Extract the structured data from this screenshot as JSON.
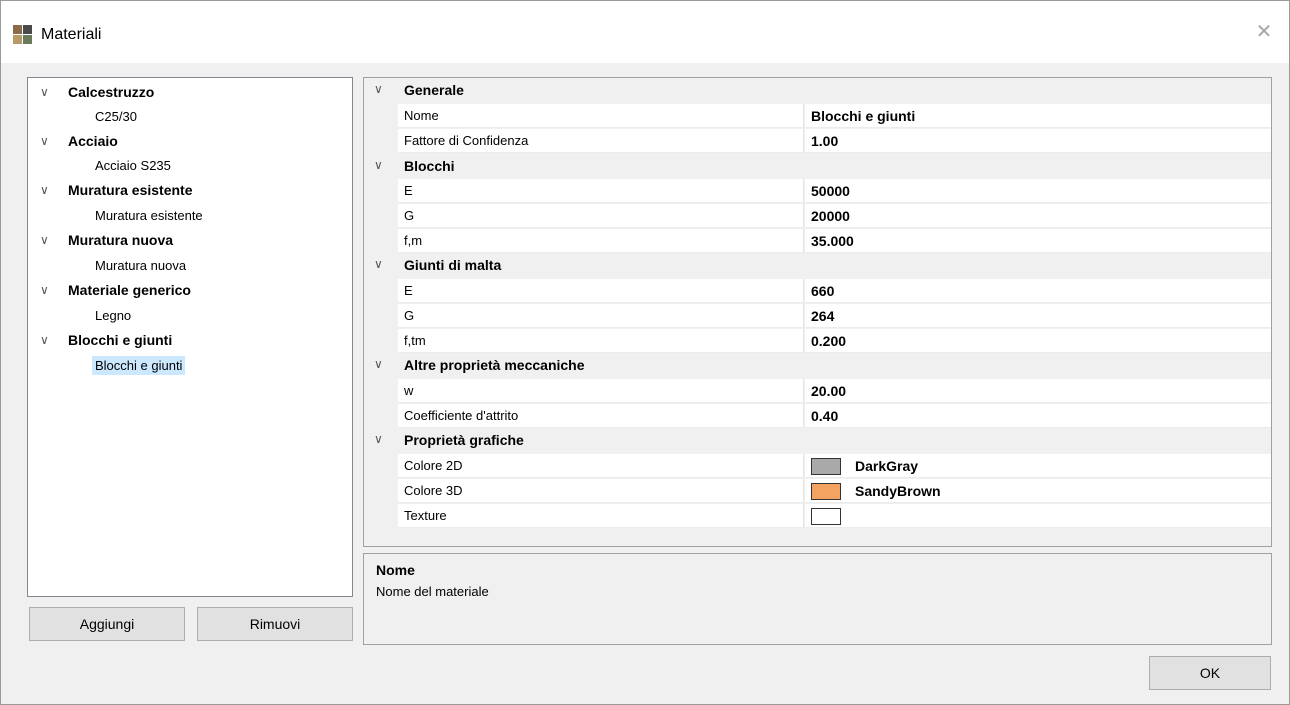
{
  "window": {
    "title": "Materiali",
    "close_glyph": "✕"
  },
  "tree": [
    {
      "category": "Calcestruzzo",
      "child": "C25/30"
    },
    {
      "category": "Acciaio",
      "child": "Acciaio S235"
    },
    {
      "category": "Muratura esistente",
      "child": "Muratura esistente"
    },
    {
      "category": "Muratura nuova",
      "child": "Muratura nuova"
    },
    {
      "category": "Materiale generico",
      "child": "Legno"
    },
    {
      "category": "Blocchi e giunti",
      "child": "Blocchi e giunti",
      "selected": true
    }
  ],
  "buttons": {
    "add": "Aggiungi",
    "remove": "Rimuovi",
    "ok": "OK"
  },
  "properties": {
    "generale": {
      "label": "Generale",
      "nome_label": "Nome",
      "nome_value": "Blocchi e giunti",
      "fc_label": "Fattore di Confidenza",
      "fc_value": "1.00"
    },
    "blocchi": {
      "label": "Blocchi",
      "e_label": "E",
      "e_value": "50000",
      "g_label": "G",
      "g_value": "20000",
      "fm_label": "f,m",
      "fm_value": "35.000"
    },
    "giunti": {
      "label": "Giunti di malta",
      "e_label": "E",
      "e_value": "660",
      "g_label": "G",
      "g_value": "264",
      "ftm_label": "f,tm",
      "ftm_value": "0.200"
    },
    "altre": {
      "label": "Altre proprietà meccaniche",
      "w_label": "w",
      "w_value": "20.00",
      "attrito_label": "Coefficiente d'attrito",
      "attrito_value": "0.40"
    },
    "grafiche": {
      "label": "Proprietà grafiche",
      "c2d_label": "Colore 2D",
      "c2d_value": "DarkGray",
      "c2d_color": "#a9a9a9",
      "c3d_label": "Colore 3D",
      "c3d_value": "SandyBrown",
      "c3d_color": "#f4a460",
      "tex_label": "Texture",
      "tex_color": "#ffffff"
    }
  },
  "help": {
    "title": "Nome",
    "description": "Nome del materiale"
  }
}
